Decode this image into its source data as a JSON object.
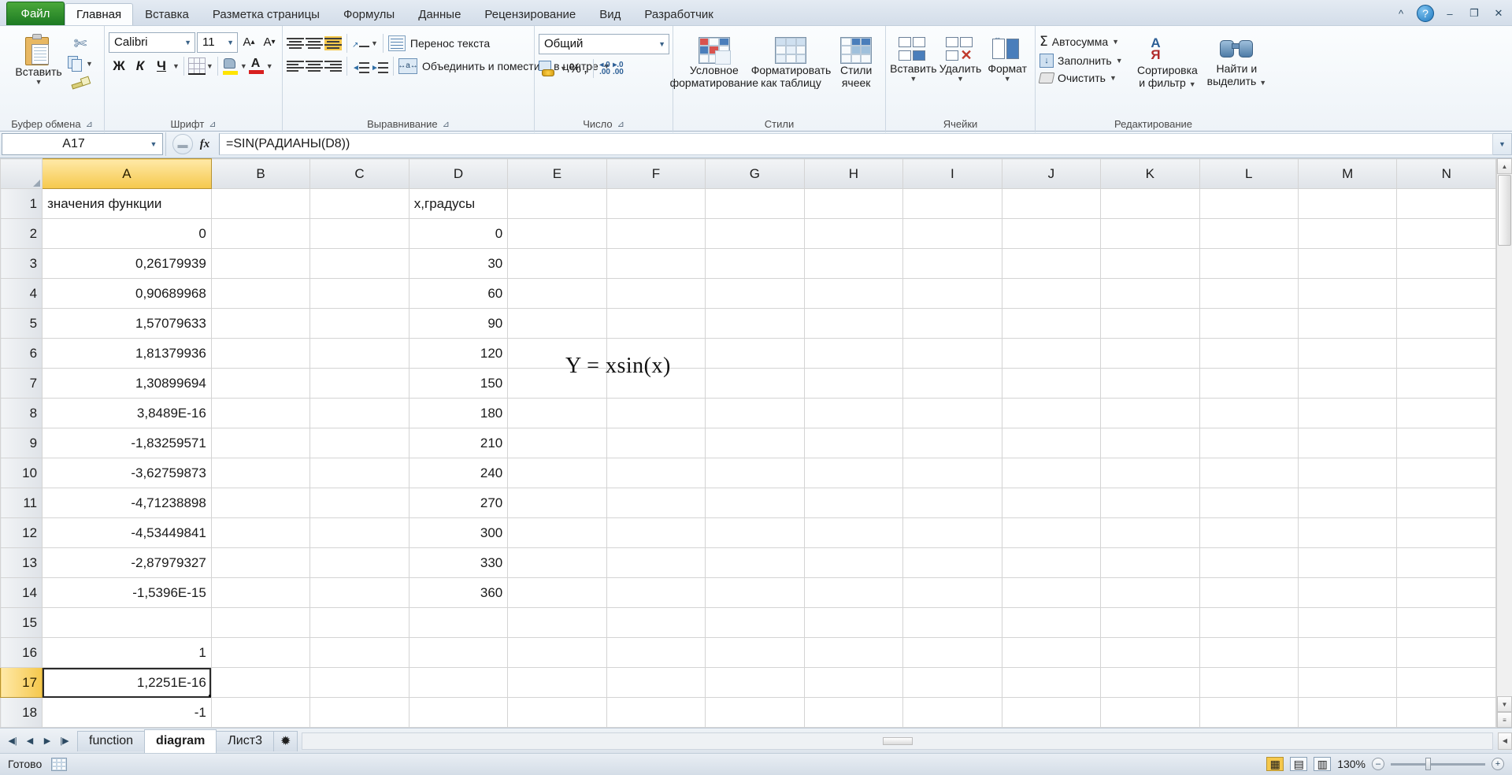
{
  "window": {
    "minimize": "–",
    "restore": "❐",
    "close": "✕",
    "help": "?",
    "collapse_ribbon": "^"
  },
  "tabs": {
    "file": "Файл",
    "items": [
      {
        "label": "Главная",
        "active": true
      },
      {
        "label": "Вставка",
        "active": false
      },
      {
        "label": "Разметка страницы",
        "active": false
      },
      {
        "label": "Формулы",
        "active": false
      },
      {
        "label": "Данные",
        "active": false
      },
      {
        "label": "Рецензирование",
        "active": false
      },
      {
        "label": "Вид",
        "active": false
      },
      {
        "label": "Разработчик",
        "active": false
      }
    ]
  },
  "ribbon": {
    "clipboard": {
      "group_label": "Буфер обмена",
      "paste": "Вставить",
      "cut_icon": "scissors-icon",
      "copy_icon": "copy-icon",
      "format_painter_icon": "format-painter-icon",
      "dialog_launcher": "⊿"
    },
    "font": {
      "group_label": "Шрифт",
      "font_name": "Calibri",
      "font_size": "11",
      "grow_font": "A",
      "shrink_font": "A",
      "bold": "Ж",
      "italic": "К",
      "underline": "Ч",
      "borders_icon": "borders-icon",
      "fill_color_icon": "fill-color-icon",
      "font_color_icon": "font-color-icon",
      "dialog_launcher": "⊿"
    },
    "alignment": {
      "group_label": "Выравнивание",
      "wrap_text": "Перенос текста",
      "merge_center": "Объединить и поместить в центре",
      "align_top_icon": "align-top-icon",
      "align_middle_icon": "align-middle-icon",
      "align_bottom_icon": "align-bottom-icon",
      "orientation_icon": "orientation-icon",
      "align_left_icon": "align-left-icon",
      "align_center_icon": "align-center-icon",
      "align_right_icon": "align-right-icon",
      "decrease_indent_icon": "decrease-indent-icon",
      "increase_indent_icon": "increase-indent-icon",
      "dialog_launcher": "⊿"
    },
    "number": {
      "group_label": "Число",
      "format": "Общий",
      "currency_icon": "currency-icon",
      "percent": "%",
      "comma": ",",
      "decrease_decimal": ".00",
      "increase_decimal": ".00",
      "dialog_launcher": "⊿"
    },
    "styles": {
      "group_label": "Стили",
      "conditional_formatting_l1": "Условное",
      "conditional_formatting_l2": "форматирование",
      "format_as_table_l1": "Форматировать",
      "format_as_table_l2": "как таблицу",
      "cell_styles_l1": "Стили",
      "cell_styles_l2": "ячеек"
    },
    "cells": {
      "group_label": "Ячейки",
      "insert": "Вставить",
      "delete": "Удалить",
      "format": "Формат"
    },
    "editing": {
      "group_label": "Редактирование",
      "autosum": "Автосумма",
      "fill": "Заполнить",
      "clear": "Очистить",
      "sort_filter_l1": "Сортировка",
      "sort_filter_l2": "и фильтр",
      "find_select_l1": "Найти и",
      "find_select_l2": "выделить"
    }
  },
  "formula_bar": {
    "name_box": "A17",
    "fx_label": "fx",
    "formula": "=SIN(РАДИАНЫ(D8))",
    "cancel_icon": "cancel-icon",
    "expand_icon": "chevron-down-icon"
  },
  "grid": {
    "columns": [
      "A",
      "B",
      "C",
      "D",
      "E",
      "F",
      "G",
      "H",
      "I",
      "J",
      "K",
      "L",
      "M",
      "N"
    ],
    "selected_column": "A",
    "selected_row": 17,
    "active_cell": "A17",
    "overlay_formula": "Y = xsin(x)",
    "rows": [
      {
        "num": "1",
        "A": "значения функции",
        "D": "х,градусы",
        "a_align": "left",
        "d_align": "left"
      },
      {
        "num": "2",
        "A": "0",
        "D": "0",
        "a_align": "right",
        "d_align": "right"
      },
      {
        "num": "3",
        "A": "0,26179939",
        "D": "30",
        "a_align": "right",
        "d_align": "right"
      },
      {
        "num": "4",
        "A": "0,90689968",
        "D": "60",
        "a_align": "right",
        "d_align": "right"
      },
      {
        "num": "5",
        "A": "1,57079633",
        "D": "90",
        "a_align": "right",
        "d_align": "right"
      },
      {
        "num": "6",
        "A": "1,81379936",
        "D": "120",
        "a_align": "right",
        "d_align": "right"
      },
      {
        "num": "7",
        "A": "1,30899694",
        "D": "150",
        "a_align": "right",
        "d_align": "right"
      },
      {
        "num": "8",
        "A": "3,8489E-16",
        "D": "180",
        "a_align": "right",
        "d_align": "right"
      },
      {
        "num": "9",
        "A": "-1,83259571",
        "D": "210",
        "a_align": "right",
        "d_align": "right"
      },
      {
        "num": "10",
        "A": "-3,62759873",
        "D": "240",
        "a_align": "right",
        "d_align": "right"
      },
      {
        "num": "11",
        "A": "-4,71238898",
        "D": "270",
        "a_align": "right",
        "d_align": "right"
      },
      {
        "num": "12",
        "A": "-4,53449841",
        "D": "300",
        "a_align": "right",
        "d_align": "right"
      },
      {
        "num": "13",
        "A": "-2,87979327",
        "D": "330",
        "a_align": "right",
        "d_align": "right"
      },
      {
        "num": "14",
        "A": "-1,5396E-15",
        "D": "360",
        "a_align": "right",
        "d_align": "right"
      },
      {
        "num": "15",
        "A": "",
        "D": "",
        "a_align": "right",
        "d_align": "right"
      },
      {
        "num": "16",
        "A": "1",
        "D": "",
        "a_align": "right",
        "d_align": "right"
      },
      {
        "num": "17",
        "A": "1,2251E-16",
        "D": "",
        "a_align": "right",
        "d_align": "right"
      },
      {
        "num": "18",
        "A": "-1",
        "D": "",
        "a_align": "right",
        "d_align": "right"
      }
    ]
  },
  "sheet_tabs": {
    "nav_first": "◀|",
    "nav_prev": "◀",
    "nav_next": "▶",
    "nav_last": "|▶",
    "items": [
      {
        "label": "function",
        "active": false
      },
      {
        "label": "diagram",
        "active": true
      },
      {
        "label": "Лист3",
        "active": false
      }
    ],
    "new_sheet_icon": "new-sheet-icon"
  },
  "status_bar": {
    "state": "Готово",
    "mode_icon": "sheet-icon",
    "view_normal_icon": "view-normal-icon",
    "view_layout_icon": "view-page-layout-icon",
    "view_pagebreak_icon": "view-page-break-icon",
    "zoom_out": "–",
    "zoom_in": "+",
    "zoom_level": "130%"
  },
  "colors": {
    "file_tab_green": "#2e8b2e",
    "selection_amber": "#f5c84c",
    "ribbon_bg": "#f3f7fb"
  }
}
